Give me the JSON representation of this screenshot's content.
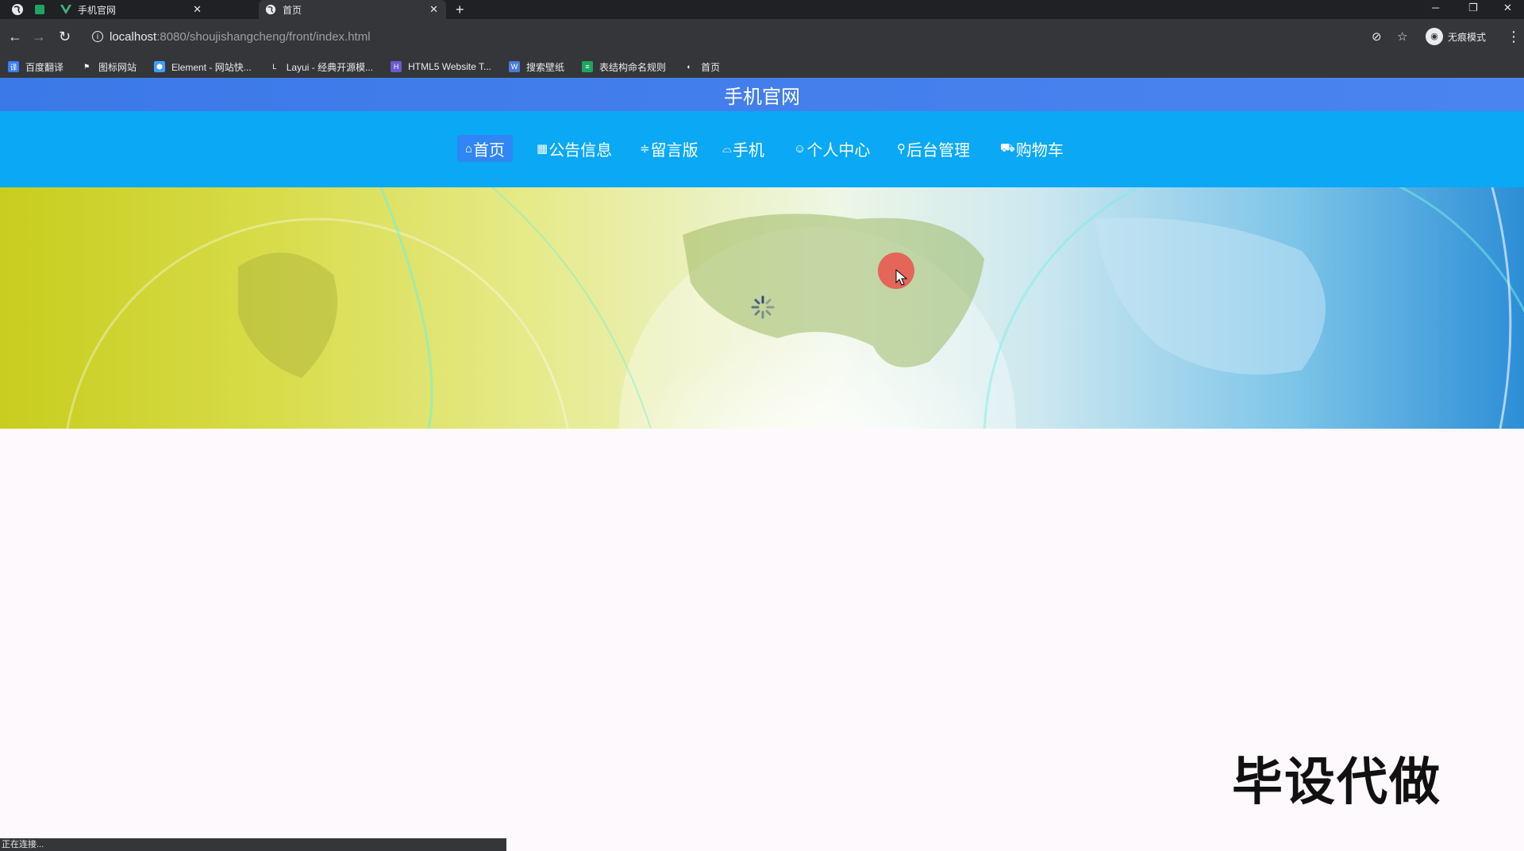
{
  "browser": {
    "tabs": [
      {
        "title": "手机官网",
        "active": false
      },
      {
        "title": "首页",
        "active": true
      }
    ],
    "url_host": "localhost",
    "url_rest": ":8080/shoujishangcheng/front/index.html",
    "profile_label": "无痕模式",
    "bookmarks": [
      {
        "label": "百度翻译",
        "color": "#3b7cf5",
        "glyph": "译"
      },
      {
        "label": "图标网站",
        "color": "#35363a",
        "glyph": "⚑"
      },
      {
        "label": "Element - 网站快...",
        "color": "#409eff",
        "glyph": "⬢"
      },
      {
        "label": "Layui - 经典开源模...",
        "color": "#35363a",
        "glyph": "L"
      },
      {
        "label": "HTML5 Website T...",
        "color": "#6a5acd",
        "glyph": "H"
      },
      {
        "label": "搜索壁纸",
        "color": "#4a7bd8",
        "glyph": "W"
      },
      {
        "label": "表结构命名规则",
        "color": "#1fa463",
        "glyph": "≡"
      },
      {
        "label": "首页",
        "color": "#35363a",
        "glyph": "◐"
      }
    ],
    "status_text": "正在连接..."
  },
  "site": {
    "title": "手机官网",
    "nav": [
      {
        "label": "首页",
        "icon": "⌂",
        "icon_name": "home-icon",
        "active": true
      },
      {
        "label": "公告信息",
        "icon": "▦",
        "icon_name": "notice-icon",
        "active": false
      },
      {
        "label": "留言版",
        "icon": "≑",
        "icon_name": "message-icon",
        "active": false
      },
      {
        "label": "手机",
        "icon": "⌓",
        "icon_name": "phone-icon",
        "active": false
      },
      {
        "label": "个人中心",
        "icon": "☺",
        "icon_name": "user-icon",
        "active": false
      },
      {
        "label": "后台管理",
        "icon": "⚲",
        "icon_name": "link-icon",
        "active": false
      },
      {
        "label": "购物车",
        "icon": "⛟",
        "icon_name": "cart-icon",
        "active": false
      }
    ]
  },
  "overlay": {
    "watermark": "毕设代做"
  }
}
